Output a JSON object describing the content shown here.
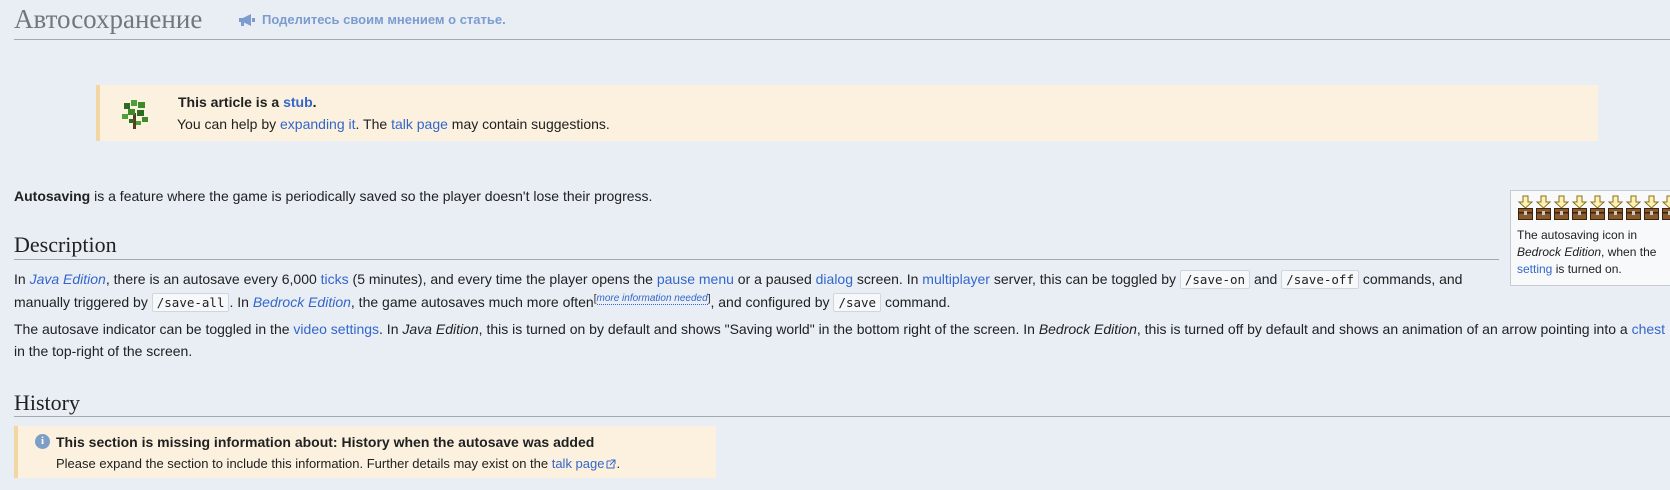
{
  "header": {
    "title": "Автосохранение",
    "feedback_link": "Поделитесь своим мнением о статье.",
    "feedback_icon": "megaphone-icon"
  },
  "stub": {
    "icon": "stub-sapling-icon",
    "title_prefix": "This article is a ",
    "title_link": "stub",
    "title_suffix": ".",
    "text_1": "You can help by ",
    "expand_link": "expanding it",
    "text_2": ". The ",
    "talk_link": "talk page",
    "text_3": " may contain suggestions."
  },
  "intro": {
    "bold": "Autosaving",
    "rest": " is a feature where the game is periodically saved so the player doesn't lose their progress."
  },
  "thumb": {
    "icon": "autosave-chest-arrow-icon",
    "frame_count": 9,
    "caption_1": "The autosaving icon in ",
    "caption_italic": "Bedrock Edition",
    "caption_2": ", when the ",
    "caption_link": "setting",
    "caption_3": " is turned on."
  },
  "description": {
    "heading": "Description",
    "p1": {
      "t1": "In ",
      "java_link": "Java Edition",
      "t2": ", there is an autosave every 6,000 ",
      "ticks_link": "ticks",
      "t3": " (5 minutes), and every time the player opens the ",
      "pause_link": "pause menu",
      "t4": " or a paused ",
      "dialog_link": "dialog",
      "t5": " screen. In ",
      "multiplayer_link": "multiplayer",
      "t6": " server, this can be toggled by ",
      "cmd_save_on": "/save-on",
      "t7": " and ",
      "cmd_save_off": "/save-off",
      "t8": " commands, and",
      "t9": "manually triggered by ",
      "cmd_save_all": "/save-all",
      "t10": ". In ",
      "bedrock_link": "Bedrock Edition",
      "t11": ", the game autosaves much more often",
      "note_open": "[",
      "note_link": "more information needed",
      "note_close": "]",
      "t12": ", and configured by ",
      "cmd_save": "/save",
      "t13": " command."
    },
    "p2": {
      "t1": "The autosave indicator can be toggled in the ",
      "video_link": "video settings",
      "t2": ". In ",
      "java": "Java Edition",
      "t3": ", this is turned on by default and shows \"Saving world\" in the bottom right of the screen. In ",
      "bedrock": "Bedrock Edition",
      "t4": ", this is turned off by default and shows an animation of an arrow pointing into a ",
      "chest_link": "chest",
      "t5": "in the top-right of the screen."
    }
  },
  "history": {
    "heading": "History",
    "notice_icon": "info-icon",
    "notice_title": "This section is missing information about: History when the autosave was added",
    "notice_text_1": "Please expand the section to include this information. Further details may exist on the ",
    "notice_link": "talk page",
    "notice_text_2": "."
  },
  "colors": {
    "background": "#e9eef4",
    "link": "#3366cc",
    "notice_bg": "#fbf1de",
    "notice_border": "#f2d7a3"
  }
}
